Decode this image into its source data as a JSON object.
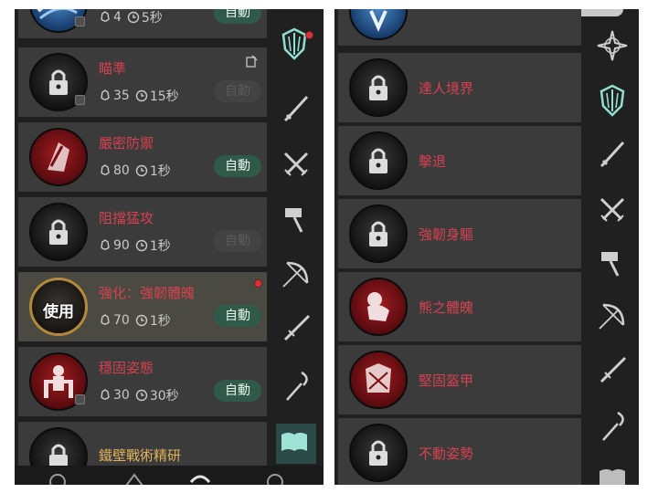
{
  "left_panel": {
    "skills": [
      {
        "name": "",
        "cost": "4",
        "cooldown": "5秒",
        "auto_label": "自動",
        "auto_enabled": true,
        "icon": "blue-swirl-icon",
        "locked": false
      },
      {
        "name": "瞄準",
        "cost": "35",
        "cooldown": "15秒",
        "auto_label": "自動",
        "auto_enabled": false,
        "icon": "lock-icon",
        "locked": true
      },
      {
        "name": "嚴密防禦",
        "cost": "80",
        "cooldown": "1秒",
        "auto_label": "自動",
        "auto_enabled": true,
        "icon": "shield-bash-icon",
        "locked": false
      },
      {
        "name": "阻擋猛攻",
        "cost": "90",
        "cooldown": "1秒",
        "auto_label": "自動",
        "auto_enabled": false,
        "icon": "lock-icon",
        "locked": true
      },
      {
        "name": "強化：強韌體魄",
        "cost": "70",
        "cooldown": "1秒",
        "auto_label": "自動",
        "auto_enabled": true,
        "icon": "use-icon",
        "locked": false,
        "use_label": "使用"
      },
      {
        "name": "穩固姿態",
        "cost": "30",
        "cooldown": "30秒",
        "auto_label": "自動",
        "auto_enabled": true,
        "icon": "stance-icon",
        "locked": false
      },
      {
        "name": "鐵壁戰術精研",
        "icon": "lock-icon",
        "locked": true
      }
    ],
    "categories": [
      "shield-icon",
      "sword-icon",
      "crossed-swords-icon",
      "hammer-icon",
      "bow-icon",
      "dagger-icon",
      "staff-icon",
      "book-icon"
    ]
  },
  "right_panel": {
    "skills": [
      {
        "name": "",
        "icon": "blue-emblem-icon",
        "locked": false
      },
      {
        "name": "達人境界",
        "icon": "lock-icon",
        "locked": true
      },
      {
        "name": "擊退",
        "icon": "lock-icon",
        "locked": true
      },
      {
        "name": "強韌身驅",
        "icon": "lock-icon",
        "locked": true
      },
      {
        "name": "熊之體魄",
        "icon": "bear-icon",
        "locked": false
      },
      {
        "name": "堅固盔甲",
        "icon": "armor-icon",
        "locked": false
      },
      {
        "name": "不動姿勢",
        "icon": "lock-icon",
        "locked": true
      }
    ],
    "categories": [
      "compass-icon",
      "shield-icon",
      "sword-icon",
      "crossed-swords-icon",
      "hammer-icon",
      "bow-icon",
      "dagger-icon",
      "staff-icon",
      "book-icon"
    ]
  },
  "colors": {
    "panel_bg": "#202020",
    "card_bg": "#3b3b3b",
    "name_red": "#d6414f",
    "name_gold": "#e2b25a",
    "auto_green": "#2f5a4a",
    "shield_teal": "#8fe0d0"
  }
}
